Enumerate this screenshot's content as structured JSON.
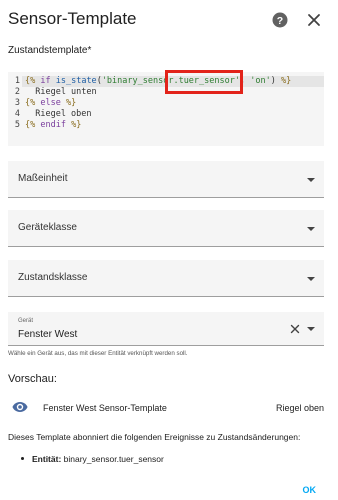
{
  "dialog": {
    "title": "Sensor-Template",
    "help_icon": "help-circle-icon",
    "close_icon": "close-icon"
  },
  "template": {
    "label": "Zustandstemplate*",
    "lines": [
      {
        "num": "1",
        "tokens": [
          {
            "t": "{%",
            "c": "delim"
          },
          {
            "t": " if ",
            "c": "kw"
          },
          {
            "t": "is_state",
            "c": "fn"
          },
          {
            "t": "(",
            "c": "plain"
          },
          {
            "t": "'binary_sensor.tuer_sensor'",
            "c": "str"
          },
          {
            "t": ", ",
            "c": "plain"
          },
          {
            "t": "'on'",
            "c": "str"
          },
          {
            "t": ") ",
            "c": "plain"
          },
          {
            "t": "%}",
            "c": "delim"
          }
        ]
      },
      {
        "num": "2",
        "tokens": [
          {
            "t": "  Riegel unten",
            "c": "plain"
          }
        ]
      },
      {
        "num": "3",
        "tokens": [
          {
            "t": "{%",
            "c": "delim"
          },
          {
            "t": " else ",
            "c": "kw"
          },
          {
            "t": "%}",
            "c": "delim"
          }
        ]
      },
      {
        "num": "4",
        "tokens": [
          {
            "t": "  Riegel oben",
            "c": "plain"
          }
        ]
      },
      {
        "num": "5",
        "tokens": [
          {
            "t": "{%",
            "c": "delim"
          },
          {
            "t": " endif ",
            "c": "kw"
          },
          {
            "t": "%}",
            "c": "delim"
          }
        ]
      }
    ],
    "highlight_color": "#e2231a"
  },
  "fields": {
    "unit_label": "Maßeinheit",
    "device_class_label": "Geräteklasse",
    "state_class_label": "Zustandsklasse",
    "device": {
      "label": "Gerät",
      "value": "Fenster West",
      "helper": "Wähle ein Gerät aus, das mit dieser Entität verknüpft werden soll."
    }
  },
  "preview": {
    "heading": "Vorschau:",
    "icon": "eye-icon",
    "entity_name": "Fenster West Sensor-Template",
    "state": "Riegel oben",
    "events_intro": "Dieses Template abonniert die folgenden Ereignisse zu Zustandsänderungen:",
    "entity_prefix": "Entität:",
    "entity_id": "binary_sensor.tuer_sensor"
  },
  "actions": {
    "ok_label": "OK"
  },
  "colors": {
    "accent": "#03a9f4",
    "icon": "#616161"
  }
}
